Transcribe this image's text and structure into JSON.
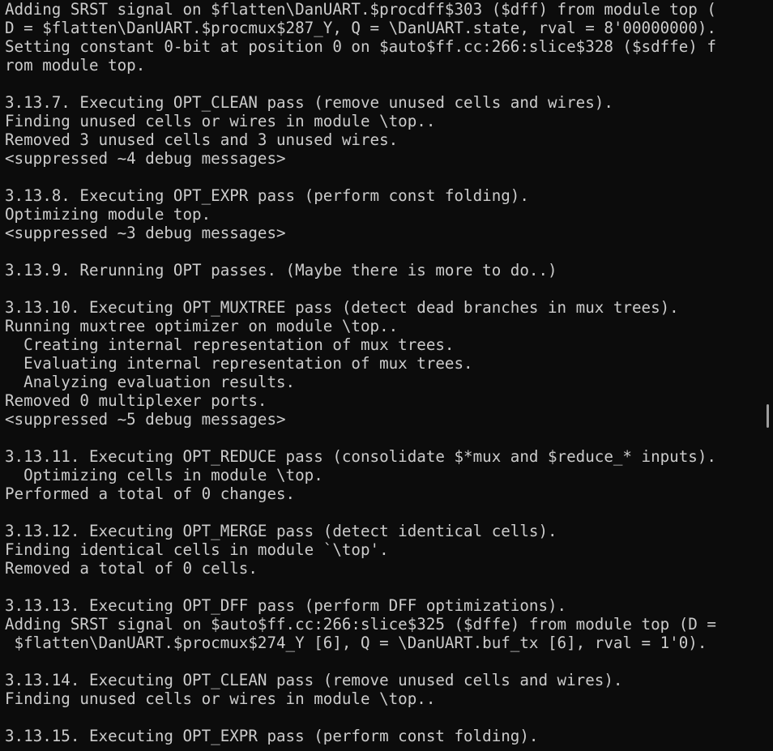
{
  "terminal": {
    "lines": [
      "Adding SRST signal on $flatten\\DanUART.$procdff$303 ($dff) from module top (",
      "D = $flatten\\DanUART.$procmux$287_Y, Q = \\DanUART.state, rval = 8'00000000).",
      "Setting constant 0-bit at position 0 on $auto$ff.cc:266:slice$328 ($sdffe) f",
      "rom module top.",
      "",
      "3.13.7. Executing OPT_CLEAN pass (remove unused cells and wires).",
      "Finding unused cells or wires in module \\top..",
      "Removed 3 unused cells and 3 unused wires.",
      "<suppressed ~4 debug messages>",
      "",
      "3.13.8. Executing OPT_EXPR pass (perform const folding).",
      "Optimizing module top.",
      "<suppressed ~3 debug messages>",
      "",
      "3.13.9. Rerunning OPT passes. (Maybe there is more to do..)",
      "",
      "3.13.10. Executing OPT_MUXTREE pass (detect dead branches in mux trees).",
      "Running muxtree optimizer on module \\top..",
      "  Creating internal representation of mux trees.",
      "  Evaluating internal representation of mux trees.",
      "  Analyzing evaluation results.",
      "Removed 0 multiplexer ports.",
      "<suppressed ~5 debug messages>",
      "",
      "3.13.11. Executing OPT_REDUCE pass (consolidate $*mux and $reduce_* inputs).",
      "  Optimizing cells in module \\top.",
      "Performed a total of 0 changes.",
      "",
      "3.13.12. Executing OPT_MERGE pass (detect identical cells).",
      "Finding identical cells in module `\\top'.",
      "Removed a total of 0 cells.",
      "",
      "3.13.13. Executing OPT_DFF pass (perform DFF optimizations).",
      "Adding SRST signal on $auto$ff.cc:266:slice$325 ($dffe) from module top (D =",
      " $flatten\\DanUART.$procmux$274_Y [6], Q = \\DanUART.buf_tx [6], rval = 1'0).",
      "",
      "3.13.14. Executing OPT_CLEAN pass (remove unused cells and wires).",
      "Finding unused cells or wires in module \\top..",
      "",
      "3.13.15. Executing OPT_EXPR pass (perform const folding)."
    ]
  },
  "colors": {
    "background": "#0c0c0c",
    "foreground": "#cccccc",
    "scrollbar": "#9d9d9d"
  }
}
